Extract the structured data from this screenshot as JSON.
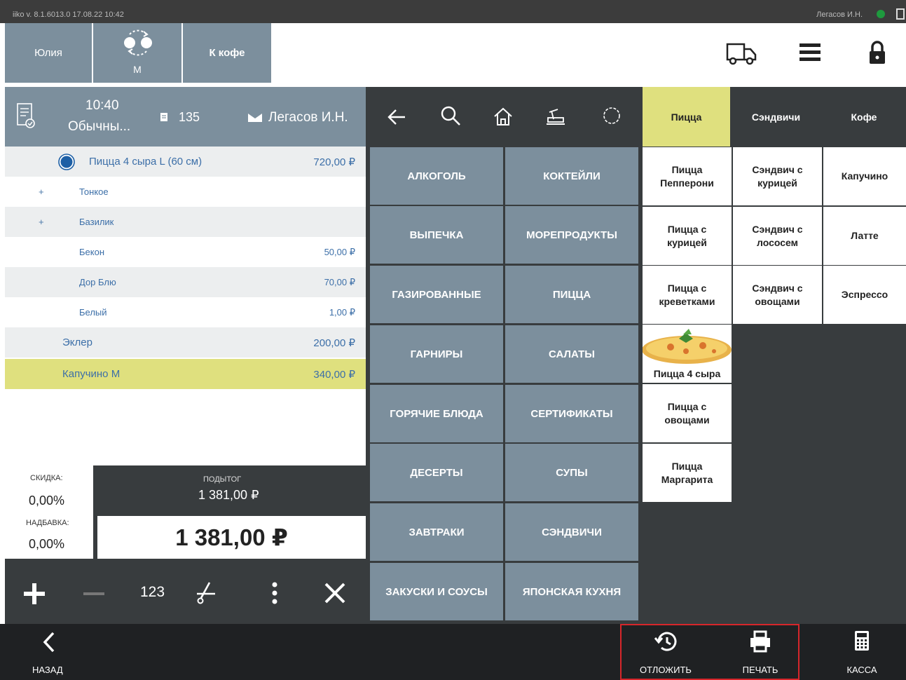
{
  "status_bar": {
    "version": "iiko v. 8.1.6013.0   17.08.22  10:42",
    "user": "Легасов И.Н."
  },
  "top_bar": {
    "btn_user": "Юлия",
    "btn_size": "М",
    "btn_coffee": "К кофе",
    "icons": [
      "truck-icon",
      "menu-icon",
      "lock-icon"
    ]
  },
  "order_header": {
    "time": "10:40",
    "type": "Обычны...",
    "number": "135",
    "waiter": "Легасов И.Н."
  },
  "order_items": [
    {
      "name": "Пицца 4 сыра L (60 см)",
      "price": "720,00 ₽"
    },
    {
      "name": "Тонкое",
      "price": "",
      "plus": "+"
    },
    {
      "name": "Базилик",
      "price": "",
      "plus": "+"
    },
    {
      "name": "Бекон",
      "price": "50,00 ₽"
    },
    {
      "name": "Дор Блю",
      "price": "70,00 ₽"
    },
    {
      "name": "Белый",
      "price": "1,00 ₽"
    },
    {
      "name": "Эклер",
      "price": "200,00 ₽"
    },
    {
      "name": "Капучино М",
      "price": "340,00 ₽"
    }
  ],
  "totals": {
    "discount_label": "СКИДКА:",
    "discount_value": "0,00%",
    "surcharge_label": "НАДБАВКА:",
    "surcharge_value": "0,00%",
    "subtotal_label": "ПОДЫТОГ",
    "subtotal_value": "1 381,00 ₽",
    "total_value": "1 381,00 ₽"
  },
  "left_toolbar": {
    "qty_label": "123"
  },
  "categories": [
    "АЛКОГОЛЬ",
    "КОКТЕЙЛИ",
    "ВЫПЕЧКА",
    "МОРЕПРОДУКТЫ",
    "ГАЗИРОВАННЫЕ",
    "ПИЦЦА",
    "ГАРНИРЫ",
    "САЛАТЫ",
    "ГОРЯЧИЕ БЛЮДА",
    "СЕРТИФИКАТЫ",
    "ДЕСЕРТЫ",
    "СУПЫ",
    "ЗАВТРАКИ",
    "СЭНДВИЧИ",
    "ЗАКУСКИ И СОУСЫ",
    "ЯПОНСКАЯ КУХНЯ"
  ],
  "tabs": [
    "Пицца",
    "Сэндвичи",
    "Кофе"
  ],
  "products": {
    "pizza": [
      "Пицца Пепперони",
      "Пицца с курицей",
      "Пицца с креветками",
      "Пицца 4 сыра",
      "Пицца с овощами",
      "Пицца Маргарита"
    ],
    "sandwich": [
      "Сэндвич с курицей",
      "Сэндвич с лососем",
      "Сэндвич с овощами"
    ],
    "coffee": [
      "Капучино",
      "Латте",
      "Эспрессо"
    ]
  },
  "bottom_bar": {
    "back": "НАЗАД",
    "postpone": "ОТЛОЖИТЬ",
    "print": "ПЕЧАТЬ",
    "cash": "КАССА"
  },
  "colors": {
    "slate": "#7c8f9d",
    "dark": "#383c3e",
    "highlight": "#dfe07e",
    "accent_blue": "#3c6fa8",
    "red_outline": "#d6262b"
  }
}
